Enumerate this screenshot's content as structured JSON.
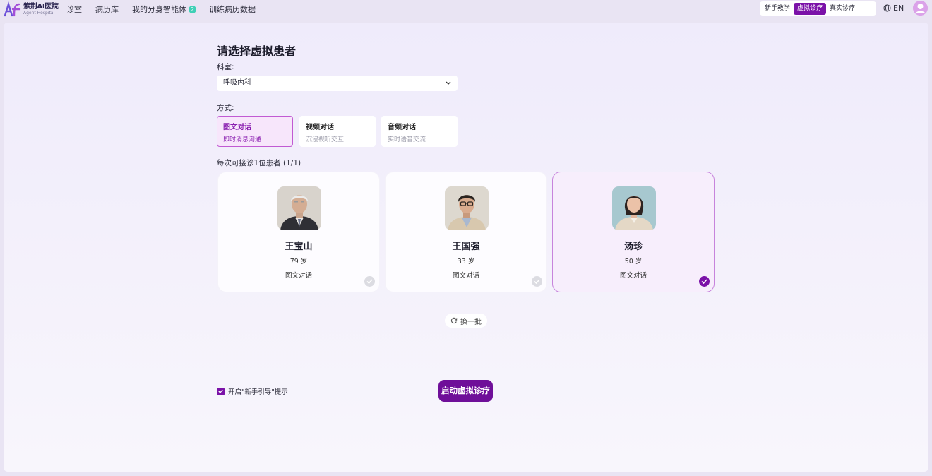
{
  "brand": {
    "name": "紫荆AI医院",
    "subtitle": "Agent Hospital"
  },
  "nav": {
    "items": [
      {
        "label": "诊室"
      },
      {
        "label": "病历库"
      },
      {
        "label": "我的分身智能体",
        "badge": "2"
      },
      {
        "label": "训练病历数据"
      }
    ]
  },
  "mode_switch": {
    "items": [
      "新手教学",
      "虚拟诊疗",
      "真实诊疗"
    ],
    "active": "虚拟诊疗"
  },
  "language": {
    "label": "EN"
  },
  "page": {
    "title": "请选择虚拟患者",
    "department_label": "科室:",
    "department_value": "呼吸内科",
    "method_label": "方式:",
    "methods": [
      {
        "title": "图文对话",
        "subtitle": "即时消息沟通",
        "active": true
      },
      {
        "title": "视频对话",
        "subtitle": "沉浸视听交互",
        "active": false
      },
      {
        "title": "音频对话",
        "subtitle": "实时语音交流",
        "active": false
      }
    ],
    "patients_label": "每次可接诊1位患者 (1/1)",
    "patients": [
      {
        "name": "王宝山",
        "age": "79 岁",
        "mode": "图文对话",
        "selected": false
      },
      {
        "name": "王国强",
        "age": "33 岁",
        "mode": "图文对话",
        "selected": false
      },
      {
        "name": "汤珍",
        "age": "50 岁",
        "mode": "图文对话",
        "selected": true
      }
    ],
    "refresh_label": "换一批",
    "guide_label": "开启\"新手引导\"提示",
    "guide_checked": true,
    "start_label": "启动虚拟诊疗"
  },
  "colors": {
    "accent": "#7b12a8",
    "accent_light": "#f7e6fb",
    "badge": "#3fd0b6"
  }
}
